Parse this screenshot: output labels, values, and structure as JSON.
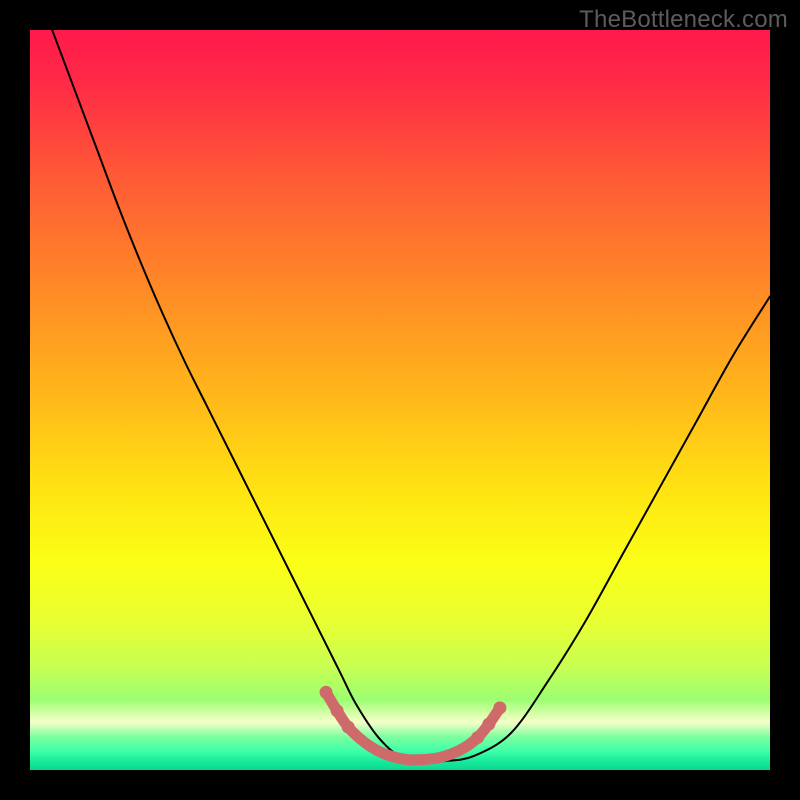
{
  "watermark": "TheBottleneck.com",
  "chart_data": {
    "type": "line",
    "title": "",
    "xlabel": "",
    "ylabel": "",
    "xlim": [
      0,
      100
    ],
    "ylim": [
      0,
      100
    ],
    "grid": false,
    "legend": false,
    "gradient_stops": [
      {
        "offset": 0.0,
        "color": "#ff1a4b"
      },
      {
        "offset": 0.07,
        "color": "#ff2a46"
      },
      {
        "offset": 0.2,
        "color": "#ff5a36"
      },
      {
        "offset": 0.35,
        "color": "#ff8a26"
      },
      {
        "offset": 0.5,
        "color": "#ffb91a"
      },
      {
        "offset": 0.62,
        "color": "#ffe312"
      },
      {
        "offset": 0.72,
        "color": "#fbff16"
      },
      {
        "offset": 0.8,
        "color": "#e8ff32"
      },
      {
        "offset": 0.86,
        "color": "#c8ff52"
      },
      {
        "offset": 0.905,
        "color": "#9cff72"
      },
      {
        "offset": 0.935,
        "color": "#f6ffc8"
      },
      {
        "offset": 0.955,
        "color": "#7effa0"
      },
      {
        "offset": 0.975,
        "color": "#3cffa8"
      },
      {
        "offset": 0.99,
        "color": "#14e89a"
      },
      {
        "offset": 1.0,
        "color": "#0cd890"
      }
    ],
    "series": [
      {
        "name": "bottleneck-curve",
        "stroke": "#000000",
        "stroke_width": 2,
        "x": [
          3,
          6,
          9,
          12,
          15,
          18,
          21,
          24,
          27,
          30,
          33,
          36,
          38,
          40,
          42,
          44,
          47,
          50,
          53,
          56,
          60,
          65,
          70,
          75,
          80,
          85,
          90,
          95,
          100
        ],
        "y": [
          100,
          92,
          84,
          76,
          68.5,
          61.5,
          55,
          49,
          43,
          37,
          31,
          25,
          21,
          17,
          13,
          9,
          4.5,
          1.8,
          1.2,
          1.2,
          1.9,
          5,
          12,
          20,
          29,
          38,
          47,
          56,
          64
        ]
      },
      {
        "name": "sweet-spot-band",
        "stroke": "#cf6a6a",
        "stroke_width": 11,
        "linecap": "round",
        "x": [
          40,
          41.5,
          43,
          45,
          47,
          49,
          51,
          53,
          55,
          57,
          59,
          60.5,
          62,
          63.5
        ],
        "y": [
          10.5,
          8.0,
          5.8,
          3.9,
          2.6,
          1.8,
          1.4,
          1.4,
          1.6,
          2.2,
          3.2,
          4.4,
          6.2,
          8.4
        ]
      }
    ],
    "markers": {
      "name": "sweet-spot-dots",
      "fill": "#cf6a6a",
      "radius": 6.5,
      "points": [
        {
          "x": 40.0,
          "y": 10.5
        },
        {
          "x": 41.5,
          "y": 8.0
        },
        {
          "x": 43.0,
          "y": 5.8
        },
        {
          "x": 60.5,
          "y": 4.4
        },
        {
          "x": 62.0,
          "y": 6.2
        },
        {
          "x": 63.5,
          "y": 8.4
        }
      ]
    }
  }
}
